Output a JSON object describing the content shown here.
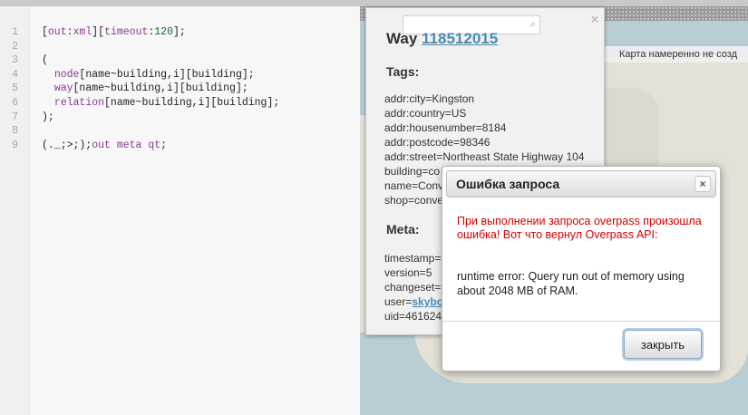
{
  "editor": {
    "line_numbers": [
      "1",
      "2",
      "3",
      "4",
      "5",
      "6",
      "7",
      "8",
      "9"
    ],
    "lines": [
      [
        "[",
        {
          "kw": "out"
        },
        ":",
        {
          "kw": "xml"
        },
        "][",
        {
          "kw": "timeout"
        },
        ":",
        {
          "num": "120"
        },
        "];"
      ],
      [],
      [
        "("
      ],
      [
        "  ",
        {
          "kw": "node"
        },
        "[name~building,i][building];"
      ],
      [
        "  ",
        {
          "kw": "way"
        },
        "[name~building,i][building];"
      ],
      [
        "  ",
        {
          "kw": "relation"
        },
        "[name~building,i][building];"
      ],
      [
        ");"
      ],
      [],
      [
        "(._;>;);",
        {
          "kw": "out"
        },
        " ",
        {
          "kw": "meta"
        },
        " ",
        {
          "kw": "qt"
        },
        ";"
      ]
    ]
  },
  "map": {
    "zoom_in": "+",
    "zoom_out": "−",
    "attribution": "Карта намеренно не созд",
    "tools": [
      "search-icon",
      "circle-icon",
      "image-icon",
      "arrow-left-icon",
      "no-data-icon"
    ],
    "tool_glyphs": [
      "⌕",
      "○",
      "▭",
      "⇤",
      "⊘"
    ]
  },
  "popup": {
    "title_prefix": "Way ",
    "way_id": "118512015",
    "tags_heading": "Tags:",
    "tags": [
      "addr:city=Kingston",
      "addr:country=US",
      "addr:housenumber=8184",
      "addr:postcode=98346",
      "addr:street=Northeast State Highway 104",
      "building=co",
      "name=Conv",
      "shop=conve"
    ],
    "meta_heading": "Meta:",
    "meta": [
      "timestamp=",
      "version=5",
      "changeset=",
      "uid=461624"
    ],
    "user_prefix": "user=",
    "user_name": "skybo",
    "close": "×"
  },
  "dialog": {
    "title": "Ошибка запроса",
    "close": "×",
    "error_text": "При выполнении запроса overpass произошла ошибка! Вот что вернул Overpass API:",
    "message": "runtime error: Query run out of memory using about 2048 MB of RAM.",
    "button": "закрыть"
  },
  "colors": {
    "keyword": "#8a3a8f",
    "number": "#116644",
    "error": "#d40000",
    "link": "#4b8bb0",
    "water": "#b9cdd4",
    "land": "#e4e2d6"
  }
}
